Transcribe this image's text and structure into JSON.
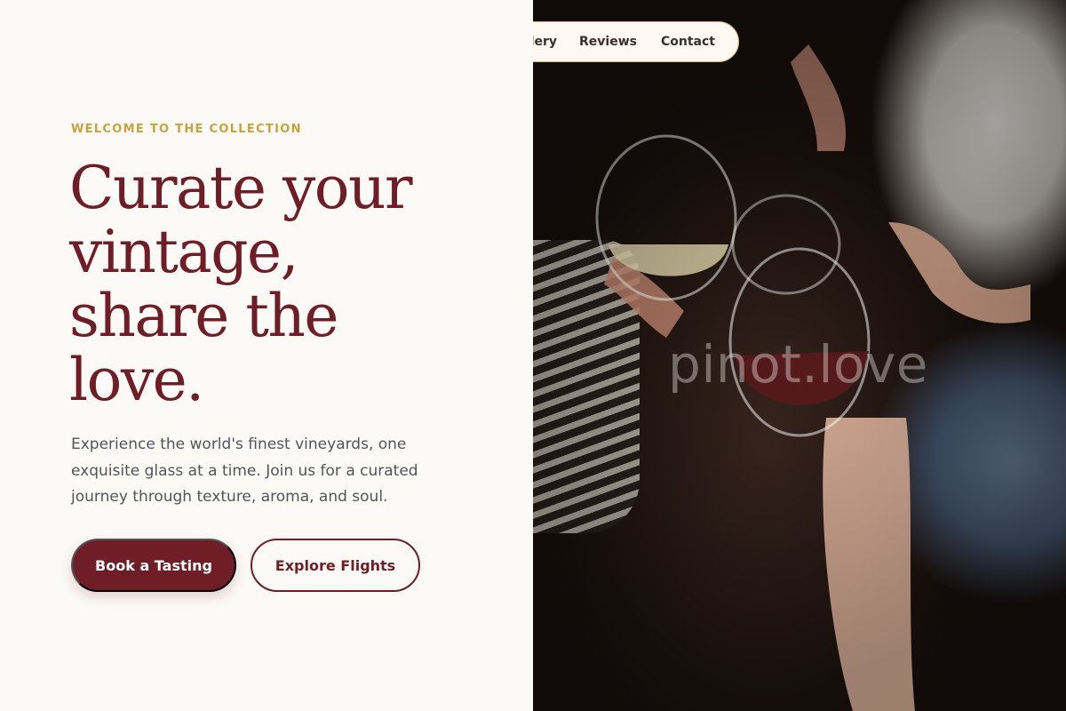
{
  "nav": {
    "items": [
      {
        "label": "Gallery"
      },
      {
        "label": "Reviews"
      },
      {
        "label": "Contact"
      }
    ]
  },
  "hero": {
    "eyebrow": "WELCOME TO THE COLLECTION",
    "headline_lines": [
      "Curate your",
      "vintage,",
      "share the",
      "love."
    ],
    "lede": "Experience the world's finest vineyards, one exquisite glass at a time. Join us for a curated journey through texture, aroma, and soul.",
    "primary_cta": "Book a Tasting",
    "secondary_cta": "Explore Flights"
  },
  "photo": {
    "watermark": "pinot.love"
  },
  "colors": {
    "brand_burgundy": "#6f1d26",
    "accent_gold": "#c9a23d",
    "background_cream": "#fcfaf6",
    "body_text": "#4f555c"
  }
}
